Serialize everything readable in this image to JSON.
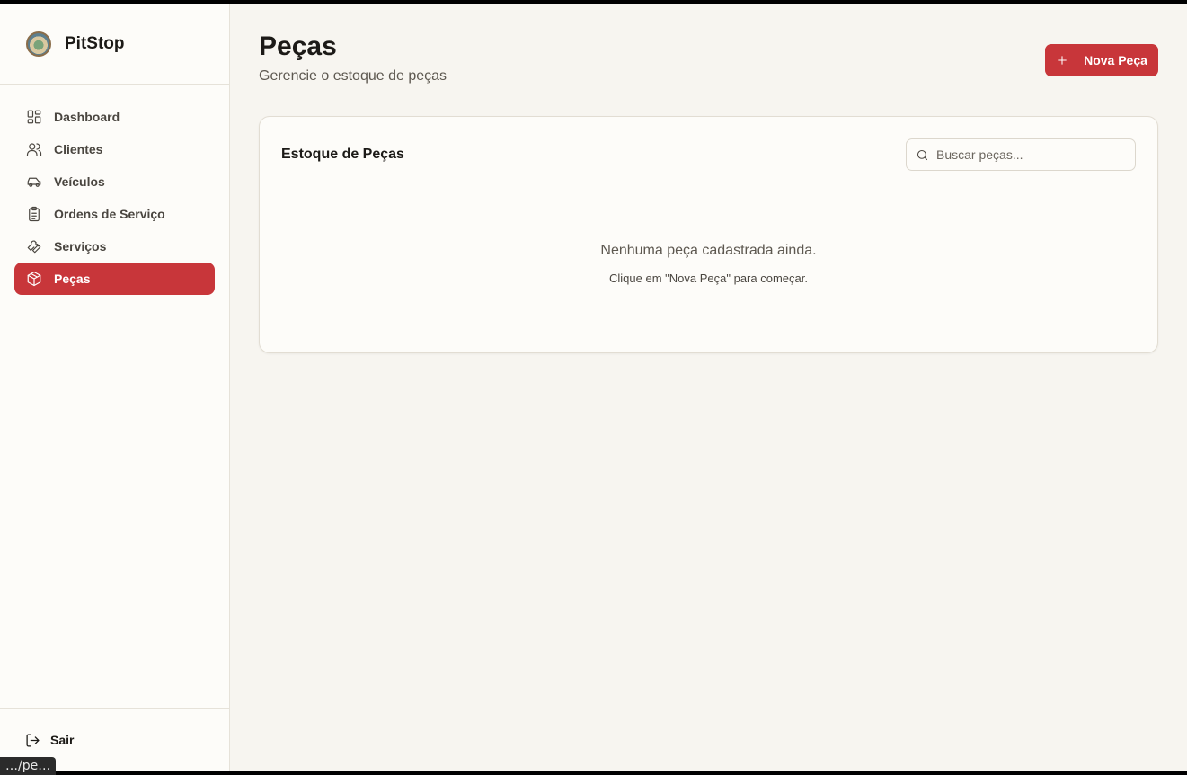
{
  "brand": {
    "name": "PitStop",
    "logo_icon": "pitstop-logo-icon"
  },
  "sidebar": {
    "items": [
      {
        "label": "Dashboard",
        "icon": "dashboard-grid-icon",
        "active": false
      },
      {
        "label": "Clientes",
        "icon": "users-icon",
        "active": false
      },
      {
        "label": "Veículos",
        "icon": "car-icon",
        "active": false
      },
      {
        "label": "Ordens de Serviço",
        "icon": "clipboard-icon",
        "active": false
      },
      {
        "label": "Serviços",
        "icon": "wrench-icon",
        "active": false
      },
      {
        "label": "Peças",
        "icon": "package-icon",
        "active": true
      }
    ],
    "logout_label": "Sair"
  },
  "status_url": "…/pe…",
  "header": {
    "title": "Peças",
    "subtitle": "Gerencie o estoque de peças",
    "new_button_label": "Nova Peça"
  },
  "card": {
    "title": "Estoque de Peças",
    "search_placeholder": "Buscar peças...",
    "search_value": "",
    "empty_message": "Nenhuma peça cadastrada ainda.",
    "empty_hint": "Clique em \"Nova Peça\" para começar."
  },
  "colors": {
    "accent": "#c8363a",
    "background": "#f7f5f0",
    "sidebar": "#fdfcf9"
  }
}
